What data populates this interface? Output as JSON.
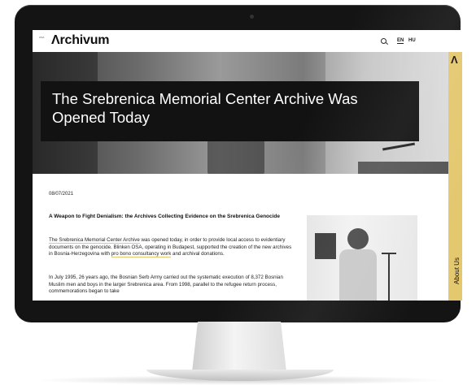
{
  "header": {
    "logo_small": "OSA",
    "logo": "Λrchivum",
    "search_icon": "search-icon",
    "lang_en": "EN",
    "lang_hu": "HU"
  },
  "hero": {
    "title": "The Srebrenica Memorial Center Archive Was Opened Today"
  },
  "sidebar": {
    "mark": "Λ",
    "label": "About Us",
    "color": "#e4c870"
  },
  "article": {
    "date": "08/07/2021",
    "headline": "A Weapon to Fight Denialism: the Archives Collecting Evidence on the Srebrenica Genocide",
    "p1_link": "The Srebrenica Memorial Center Archive",
    "p1_a": " was opened today, in order to provide local access to evidentiary documents on the genocide. Blinken OSA, operating in Budapest, supported the creation of the new archives in Bosnia-Herzegovina with ",
    "p1_link2": "pro bono consultancy work",
    "p1_b": " and archival donations.",
    "p2": "In July 1995, 26 years ago, the Bosnian Serb Army carried out the systematic execution of 8,372 Bosnian Muslim men and boys in the larger Srebrenica area. From 1998, parallel to the refugee return process, commemorations began to take"
  }
}
